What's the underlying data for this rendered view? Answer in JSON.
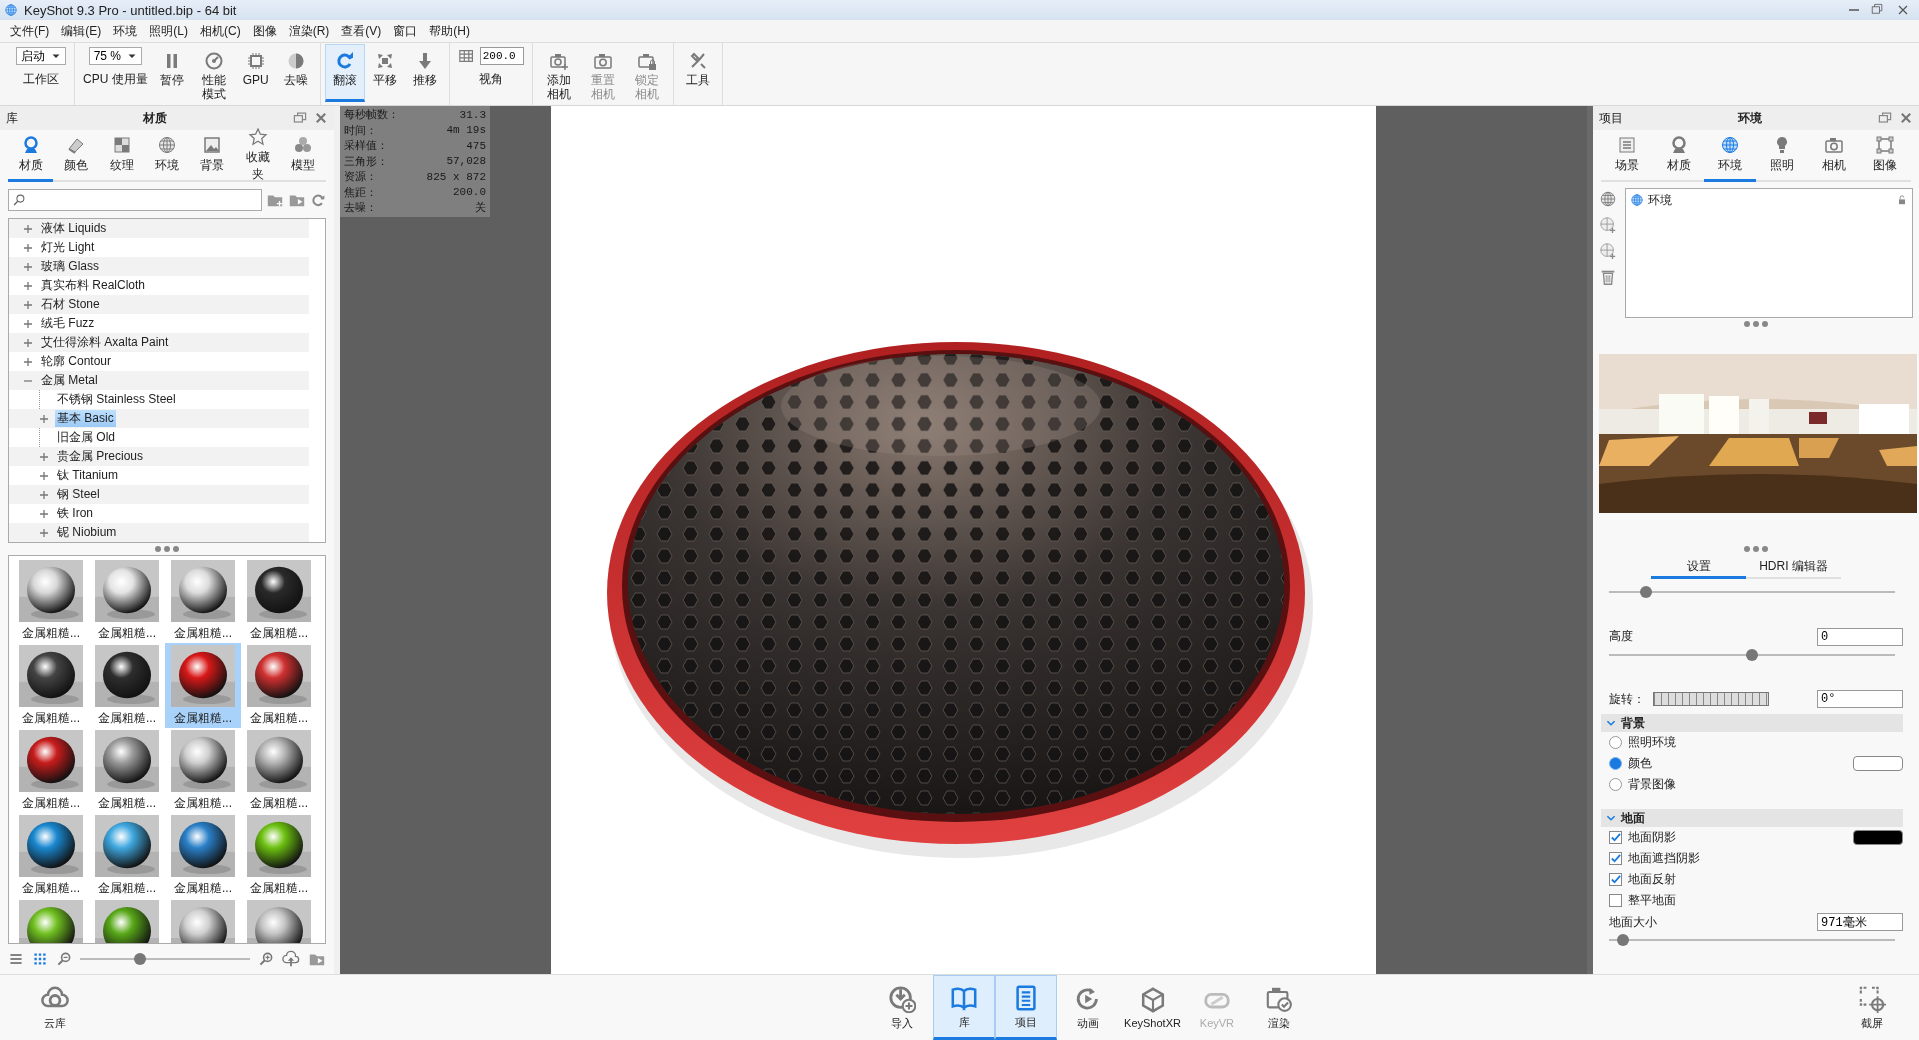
{
  "window": {
    "title": "KeyShot 9.3 Pro  - untitled.bip  - 64 bit"
  },
  "menu": [
    "文件(F)",
    "编辑(E)",
    "环境",
    "照明(L)",
    "相机(C)",
    "图像",
    "渲染(R)",
    "查看(V)",
    "窗口",
    "帮助(H)"
  ],
  "toolbar": [
    [
      {
        "kind": "select",
        "value": "启动",
        "label": "工作区"
      }
    ],
    [
      {
        "kind": "select",
        "value": "75 %",
        "label": "CPU 使用量"
      },
      {
        "kind": "button",
        "label": "暂停",
        "selected": false,
        "disabled": false
      },
      {
        "kind": "button",
        "label": "性能模式",
        "selected": false,
        "disabled": false
      },
      {
        "kind": "button",
        "label": "GPU",
        "selected": false,
        "disabled": false
      },
      {
        "kind": "button",
        "label": "去噪",
        "selected": false,
        "disabled": false
      }
    ],
    [
      {
        "kind": "button",
        "label": "翻滚",
        "selected": true,
        "disabled": false
      },
      {
        "kind": "button",
        "label": "平移",
        "selected": false,
        "disabled": false
      },
      {
        "kind": "button",
        "label": "推移",
        "selected": false,
        "disabled": false
      }
    ],
    [
      {
        "kind": "field",
        "value": "200.0",
        "label": "视角"
      }
    ],
    [
      {
        "kind": "button",
        "label": "添加相机",
        "selected": false,
        "disabled": false
      },
      {
        "kind": "button",
        "label": "重置相机",
        "selected": false,
        "disabled": true
      },
      {
        "kind": "button",
        "label": "锁定相机",
        "selected": false,
        "disabled": true
      }
    ],
    [
      {
        "kind": "button",
        "label": "工具",
        "selected": false,
        "disabled": false
      }
    ]
  ],
  "library": {
    "title": "库",
    "heading": "材质",
    "tabs": [
      {
        "label": "材质",
        "selected": true
      },
      {
        "label": "颜色",
        "selected": false
      },
      {
        "label": "纹理",
        "selected": false
      },
      {
        "label": "环境",
        "selected": false
      },
      {
        "label": "背景",
        "selected": false
      },
      {
        "label": "收藏夹",
        "selected": false
      },
      {
        "label": "模型",
        "selected": false
      }
    ],
    "tree": [
      {
        "label": "液体 Liquids",
        "kind": "group",
        "expanded": false,
        "selected": false
      },
      {
        "label": "灯光 Light",
        "kind": "group",
        "expanded": false,
        "selected": false
      },
      {
        "label": "玻璃 Glass",
        "kind": "group",
        "expanded": false,
        "selected": false
      },
      {
        "label": "真实布料 RealCloth",
        "kind": "group",
        "expanded": false,
        "selected": false
      },
      {
        "label": "石材 Stone",
        "kind": "group",
        "expanded": false,
        "selected": false
      },
      {
        "label": "绒毛 Fuzz",
        "kind": "group",
        "expanded": false,
        "selected": false
      },
      {
        "label": "艾仕得涂料 Axalta Paint",
        "kind": "group",
        "expanded": false,
        "selected": false
      },
      {
        "label": "轮廓 Contour",
        "kind": "group",
        "expanded": false,
        "selected": false
      },
      {
        "label": "金属 Metal",
        "kind": "group",
        "expanded": true,
        "selected": false,
        "children": [
          {
            "label": "不锈钢 Stainless Steel",
            "kind": "leaf",
            "selected": false
          },
          {
            "label": "基本 Basic",
            "kind": "group",
            "expanded": false,
            "selected": true
          },
          {
            "label": "旧金属 Old",
            "kind": "leaf",
            "selected": false
          },
          {
            "label": "贵金属 Precious",
            "kind": "group",
            "expanded": false,
            "selected": false
          },
          {
            "label": "钛 Titanium",
            "kind": "group",
            "expanded": false,
            "selected": false
          },
          {
            "label": "钢 Steel",
            "kind": "group",
            "expanded": false,
            "selected": false
          },
          {
            "label": "铁 Iron",
            "kind": "group",
            "expanded": false,
            "selected": false
          },
          {
            "label": "铌 Niobium",
            "kind": "group",
            "expanded": false,
            "selected": false
          }
        ]
      }
    ],
    "materials": [
      {
        "label": "金属粗糙...",
        "selected": false
      },
      {
        "label": "金属粗糙...",
        "selected": false
      },
      {
        "label": "金属粗糙...",
        "selected": false
      },
      {
        "label": "金属粗糙...",
        "selected": false
      },
      {
        "label": "金属粗糙...",
        "selected": false
      },
      {
        "label": "金属粗糙...",
        "selected": false
      },
      {
        "label": "金属粗糙...",
        "selected": true
      },
      {
        "label": "金属粗糙...",
        "selected": false
      },
      {
        "label": "金属粗糙...",
        "selected": false
      },
      {
        "label": "金属粗糙...",
        "selected": false
      },
      {
        "label": "金属粗糙...",
        "selected": false
      },
      {
        "label": "金属粗糙...",
        "selected": false
      },
      {
        "label": "金属粗糙...",
        "selected": false
      },
      {
        "label": "金属粗糙...",
        "selected": false
      },
      {
        "label": "金属粗糙...",
        "selected": false
      },
      {
        "label": "金属粗糙...",
        "selected": false
      }
    ],
    "view_modes": [
      {
        "selected": false
      },
      {
        "selected": true
      }
    ],
    "thumb_size": {
      "level": 0.35
    }
  },
  "render_stats": [
    {
      "label": "每秒帧数：",
      "value": "31.3"
    },
    {
      "label": "时间：",
      "value": "4m 19s"
    },
    {
      "label": "采样值：",
      "value": "475"
    },
    {
      "label": "三角形：",
      "value": "57,028"
    },
    {
      "label": "资源：",
      "value": "825 x 872"
    },
    {
      "label": "焦距：",
      "value": "200.0"
    },
    {
      "label": "去噪：",
      "value": "关"
    }
  ],
  "project": {
    "title": "项目",
    "heading": "环境",
    "tabs": [
      {
        "label": "场景",
        "selected": false
      },
      {
        "label": "材质",
        "selected": false
      },
      {
        "label": "环境",
        "selected": true
      },
      {
        "label": "照明",
        "selected": false
      },
      {
        "label": "相机",
        "selected": false
      },
      {
        "label": "图像",
        "selected": false
      }
    ],
    "environments": [
      {
        "label": "环境",
        "selected": false
      }
    ],
    "settings_tabs": [
      {
        "label": "设置",
        "selected": true
      },
      {
        "label": "HDRI 编辑器",
        "selected": false
      }
    ],
    "size": {
      "level": 0.13
    },
    "height": {
      "label": "高度",
      "value": "0",
      "level": 0.5
    },
    "rotation": {
      "label": "旋转：",
      "value": "0°"
    },
    "background": {
      "title": "背景",
      "expanded": true,
      "options": [
        {
          "label": "照明环境",
          "selected": false
        },
        {
          "label": "颜色",
          "selected": true,
          "color": "#ffffff"
        },
        {
          "label": "背景图像",
          "selected": false
        }
      ]
    },
    "ground": {
      "title": "地面",
      "expanded": true,
      "options": [
        {
          "label": "地面阴影",
          "checked": true,
          "color": "#000000"
        },
        {
          "label": "地面遮挡阴影",
          "checked": true
        },
        {
          "label": "地面反射",
          "checked": true
        },
        {
          "label": "整平地面",
          "checked": false
        }
      ],
      "size": {
        "label": "地面大小",
        "value": "971毫米",
        "level": 0.05
      }
    }
  },
  "dock": {
    "left": [
      {
        "label": "云库"
      }
    ],
    "center": [
      {
        "label": "导入",
        "selected": false,
        "disabled": false
      },
      {
        "label": "库",
        "selected": true,
        "disabled": false
      },
      {
        "label": "项目",
        "selected": true,
        "disabled": false
      },
      {
        "label": "动画",
        "selected": false,
        "disabled": false
      },
      {
        "label": "KeyShotXR",
        "selected": false,
        "disabled": false
      },
      {
        "label": "KeyVR",
        "selected": false,
        "disabled": true
      },
      {
        "label": "渲染",
        "selected": false,
        "disabled": false
      }
    ],
    "right": [
      {
        "label": "截屏"
      }
    ]
  }
}
